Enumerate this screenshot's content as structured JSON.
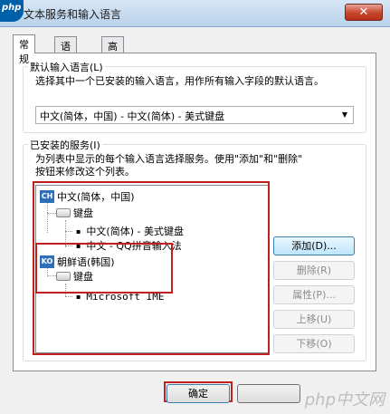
{
  "window": {
    "title": "文本服务和输入语言",
    "logo_text": "php",
    "close_glyph": "✕"
  },
  "tabs": [
    {
      "label": "常规",
      "active": true
    },
    {
      "label": "语言栏",
      "active": false
    },
    {
      "label": "高级键设置",
      "active": false
    }
  ],
  "default_language": {
    "group_label": "默认输入语言(L)",
    "description": "选择其中一个已安装的输入语言，用作所有输入字段的默认语言。",
    "selected": "中文(简体，中国) - 中文(简体) - 美式键盘",
    "dropdown_arrow": "▼"
  },
  "installed_services": {
    "group_label": "已安装的服务(I)",
    "description_line1": "为列表中显示的每个输入语言选择服务。使用\"添加\"和\"删除\"",
    "description_line2": "按钮来修改这个列表。",
    "tree": {
      "lang1": {
        "badge": "CH",
        "label": "中文(简体，中国)"
      },
      "lang1_kbd": "键盘",
      "lang1_item1": "中文(简体) - 美式键盘",
      "lang1_item2": "中文 - QQ拼音输入法",
      "lang2": {
        "badge": "KO",
        "label": "朝鲜语(韩国)"
      },
      "lang2_kbd": "键盘",
      "lang2_item1": "Microsoft IME",
      "bullet": "▪"
    },
    "buttons": {
      "add": "添加(D)...",
      "remove": "删除(R)",
      "properties": "属性(P)...",
      "move_up": "上移(U)",
      "move_down": "下移(O)"
    }
  },
  "footer": {
    "ok": "确定",
    "cancel": ""
  },
  "colors": {
    "highlight_box": "#c0201e",
    "lang_badge": "#2f6fb8"
  },
  "watermark": "php中文网"
}
